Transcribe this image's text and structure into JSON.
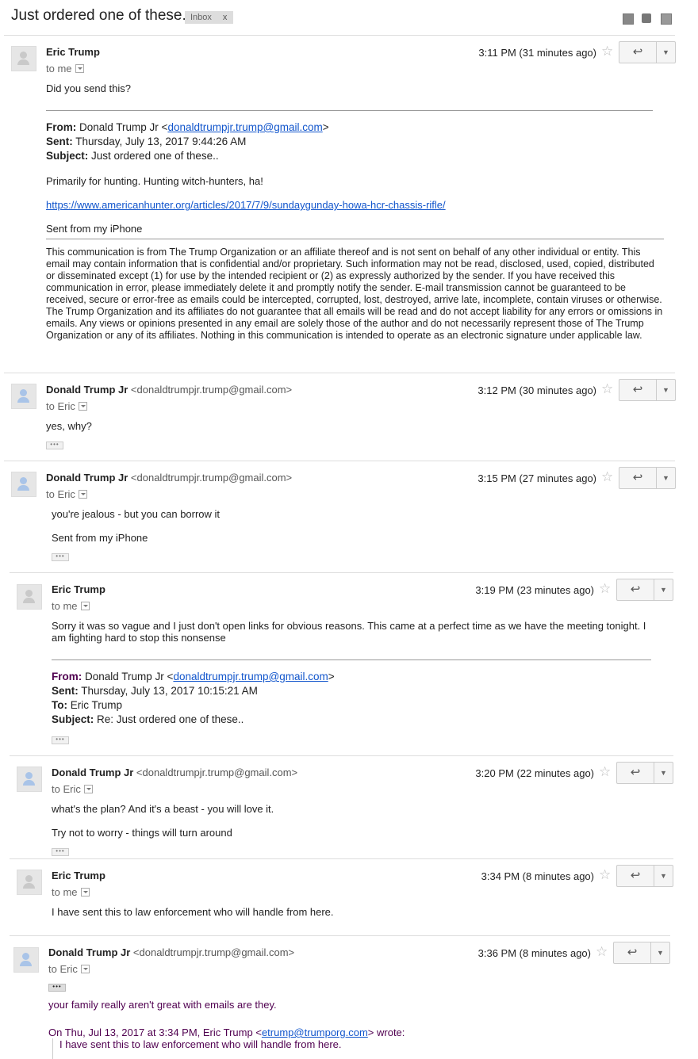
{
  "thread": {
    "subject": "Just ordered one of these..",
    "label": "Inbox",
    "label_close": "x"
  },
  "toolbar_icons": [
    "archive-icon",
    "print-icon",
    "new-window-icon"
  ],
  "messages": [
    {
      "sender": "Eric Trump",
      "to": "to me",
      "time": "3:11 PM (31 minutes ago)",
      "body": "Did you send this?",
      "forward": {
        "from_label": "From:",
        "from_name": "Donald Trump Jr <",
        "from_email": "donaldtrumpjr.trump@gmail.com",
        "from_end": ">",
        "sent_label": "Sent:",
        "sent": "Thursday, July 13, 2017 9:44:26 AM",
        "subject_label": "Subject:",
        "subject": "Just ordered one of these..",
        "body1": "Primarily for hunting. Hunting witch-hunters, ha!",
        "link": "https://www.americanhunter.org/articles/2017/7/9/sundaygunday-howa-hcr-chassis-rifle/",
        "signature": "Sent from my iPhone",
        "disclaimer": "This communication is from The Trump Organization or an affiliate thereof and is not sent on behalf of any other individual or entity. This email may contain information that is confidential and/or proprietary. Such information may not be read, disclosed, used, copied, distributed or disseminated except (1) for use by the intended recipient or (2) as expressly authorized by the sender. If you have received this communication in error, please immediately delete it and promptly notify the sender. E-mail transmission cannot be guaranteed to be received, secure or error-free as emails could be intercepted, corrupted, lost, destroyed, arrive late, incomplete, contain viruses or otherwise. The Trump Organization and its affiliates do not guarantee that all emails will be read and do not accept liability for any errors or omissions in emails. Any views or opinions presented in any email are solely those of the author and do not necessarily represent those of The Trump Organization or any of its affiliates. Nothing in this communication is intended to operate as an electronic signature under applicable law."
      }
    },
    {
      "sender": "Donald Trump Jr",
      "addr": "<donaldtrumpjr.trump@gmail.com>",
      "to": "to Eric",
      "time": "3:12 PM (30 minutes ago)",
      "body": "yes, why?"
    },
    {
      "sender": "Donald Trump Jr",
      "addr": "<donaldtrumpjr.trump@gmail.com>",
      "to": "to Eric",
      "time": "3:15 PM (27 minutes ago)",
      "body": "you're jealous - but you can borrow it",
      "signature": "Sent from my iPhone"
    },
    {
      "sender": "Eric Trump",
      "to": "to me",
      "time": "3:19 PM (23 minutes ago)",
      "body": "Sorry it was so vague and I just don't open links for obvious reasons. This came at a perfect time as we have the meeting tonight. I am fighting hard to stop this nonsense",
      "quote": {
        "from_label": "From:",
        "from_name": "Donald Trump Jr <",
        "from_email": "donaldtrumpjr.trump@gmail.com",
        "from_end": ">",
        "sent_label": "Sent:",
        "sent": "Thursday, July 13, 2017 10:15:21 AM",
        "to_label": "To:",
        "to": "Eric Trump",
        "subject_label": "Subject:",
        "subject": "Re: Just ordered one of these.."
      }
    },
    {
      "sender": "Donald Trump Jr",
      "addr": "<donaldtrumpjr.trump@gmail.com>",
      "to": "to Eric",
      "time": "3:20 PM (22 minutes ago)",
      "body": "what's the plan? And it's a beast - you will love it.",
      "body2": "Try not to worry - things will turn around"
    },
    {
      "sender": "Eric Trump",
      "to": "to me",
      "time": "3:34 PM (8 minutes ago)",
      "body": "I have sent this to law enforcement who will handle from here."
    },
    {
      "sender": "Donald Trump Jr",
      "addr": "<donaldtrumpjr.trump@gmail.com>",
      "to": "to Eric",
      "time": "3:36 PM (8 minutes ago)",
      "body": "your family really aren't great with emails are they.",
      "quote_intro": "On Thu, Jul 13, 2017 at 3:34 PM, Eric Trump <",
      "quote_email": "etrump@trumporg.com",
      "quote_intro_end": "> wrote:",
      "quoted": "I have sent this to law enforcement who will handle from here."
    }
  ],
  "ellipsis": "•••",
  "reply_glyph": "↩",
  "more_glyph": "▼",
  "star_glyph": "☆"
}
